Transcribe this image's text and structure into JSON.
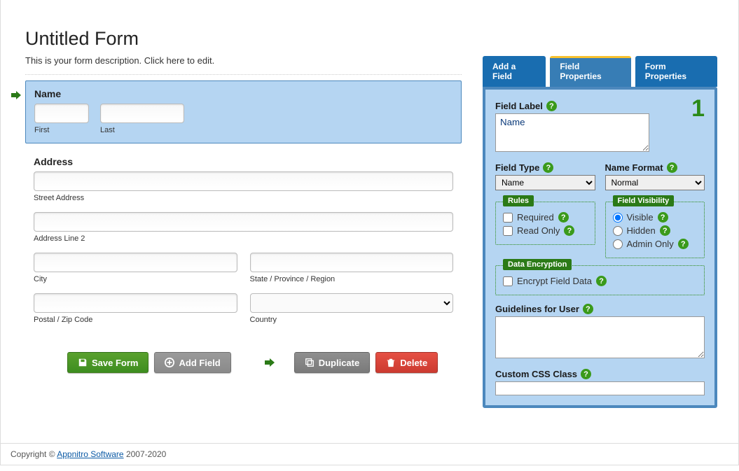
{
  "form": {
    "title": "Untitled Form",
    "description": "This is your form description. Click here to edit."
  },
  "fields": {
    "name": {
      "label": "Name",
      "first_sublabel": "First",
      "last_sublabel": "Last"
    },
    "address": {
      "label": "Address",
      "street_sublabel": "Street Address",
      "line2_sublabel": "Address Line 2",
      "city_sublabel": "City",
      "state_sublabel": "State / Province / Region",
      "postal_sublabel": "Postal / Zip Code",
      "country_sublabel": "Country"
    }
  },
  "buttons": {
    "save": "Save Form",
    "add": "Add Field",
    "duplicate": "Duplicate",
    "delete": "Delete"
  },
  "tabs": {
    "add": "Add a Field",
    "field": "Field Properties",
    "form": "Form Properties"
  },
  "props": {
    "number": "1",
    "field_label_title": "Field Label",
    "field_label_value": "Name",
    "field_type_title": "Field Type",
    "field_type_value": "Name",
    "name_format_title": "Name Format",
    "name_format_value": "Normal",
    "rules_legend": "Rules",
    "rules_required": "Required",
    "rules_readonly": "Read Only",
    "visibility_legend": "Field Visibility",
    "visibility_visible": "Visible",
    "visibility_hidden": "Hidden",
    "visibility_admin": "Admin Only",
    "encryption_legend": "Data Encryption",
    "encryption_label": "Encrypt Field Data",
    "guidelines_title": "Guidelines for User",
    "css_title": "Custom CSS Class"
  },
  "footer": {
    "prefix": "Copyright © ",
    "link": "Appnitro Software",
    "suffix": " 2007-2020"
  }
}
